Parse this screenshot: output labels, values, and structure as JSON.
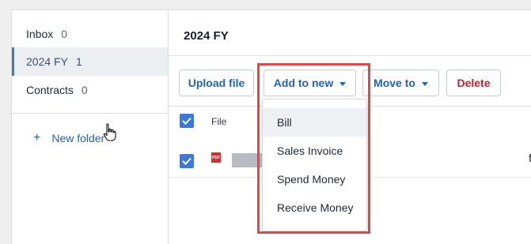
{
  "sidebar": {
    "folders": [
      {
        "label": "Inbox",
        "count": "0"
      },
      {
        "label": "2024 FY",
        "count": "1"
      },
      {
        "label": "Contracts",
        "count": "0"
      }
    ],
    "new_folder_label": "New folder"
  },
  "main": {
    "title": "2024 FY",
    "toolbar": {
      "upload_label": "Upload file",
      "add_to_new_label": "Add to new",
      "move_to_label": "Move to",
      "delete_label": "Delete"
    },
    "table": {
      "file_column": "File",
      "row_tail_text": "f"
    }
  },
  "dropdown": {
    "items": [
      "Bill",
      "Sales Invoice",
      "Spend Money",
      "Receive Money"
    ]
  },
  "colors": {
    "accent": "#1f63c2",
    "checkbox": "#3b78d8",
    "danger": "#c8202f",
    "highlight": "#e64545"
  }
}
